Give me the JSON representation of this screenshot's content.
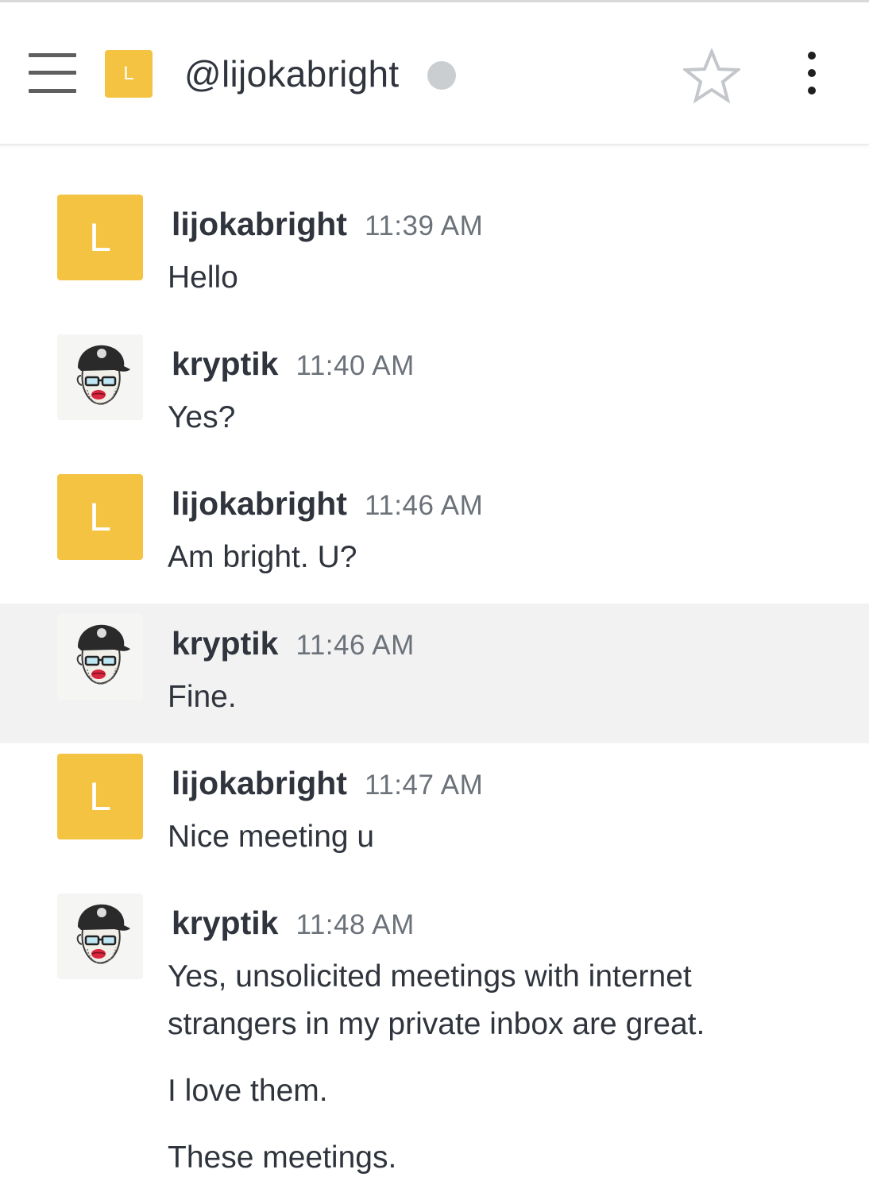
{
  "header": {
    "room_avatar_letter": "L",
    "room_title": "@lijokabright",
    "colors": {
      "avatar_bg": "#f5c342",
      "status_offline": "#cbced1",
      "highlight_row": "#f2f2f2"
    },
    "icons": {
      "menu": "hamburger-menu-icon",
      "status": "offline-status-icon",
      "favorite": "star-outline-icon",
      "more": "kebab-menu-icon"
    }
  },
  "messages": [
    {
      "user": "lijokabright",
      "avatar": "L",
      "time": "11:39 AM",
      "lines": [
        "Hello"
      ]
    },
    {
      "user": "kryptik",
      "avatar": "photo",
      "time": "11:40 AM",
      "lines": [
        "Yes?"
      ]
    },
    {
      "user": "lijokabright",
      "avatar": "L",
      "time": "11:46 AM",
      "lines": [
        "Am bright. U?"
      ]
    },
    {
      "user": "kryptik",
      "avatar": "photo",
      "time": "11:46 AM",
      "lines": [
        "Fine."
      ]
    },
    {
      "user": "lijokabright",
      "avatar": "L",
      "time": "11:47 AM",
      "lines": [
        "Nice meeting u"
      ]
    },
    {
      "user": "kryptik",
      "avatar": "photo",
      "time": "11:48 AM",
      "lines": [
        "Yes, unsolicited meetings with internet strangers in my private inbox are great.",
        "I love them.",
        "These meetings."
      ]
    }
  ]
}
